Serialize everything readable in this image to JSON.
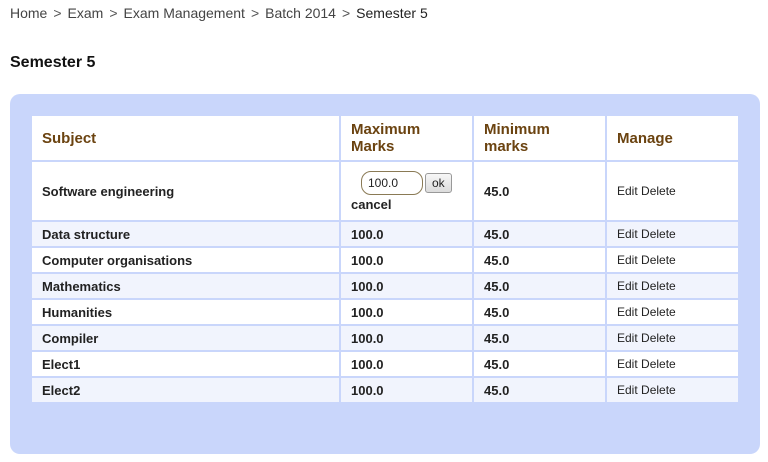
{
  "breadcrumb": {
    "items": [
      "Home",
      "Exam",
      "Exam Management",
      "Batch 2014"
    ],
    "current": "Semester 5",
    "separator": ">"
  },
  "page": {
    "title": "Semester 5"
  },
  "table": {
    "headers": {
      "subject": "Subject",
      "max_marks": "Maximum Marks",
      "min_marks": "Minimum marks",
      "manage": "Manage"
    },
    "edit_row": {
      "subject": "Software engineering",
      "max_value": "100.0",
      "ok_label": "ok",
      "cancel_label": "cancel",
      "min": "45.0"
    },
    "rows": [
      {
        "subject": "Data structure",
        "max": "100.0",
        "min": "45.0"
      },
      {
        "subject": "Computer organisations",
        "max": "100.0",
        "min": "45.0"
      },
      {
        "subject": "Mathematics",
        "max": "100.0",
        "min": "45.0"
      },
      {
        "subject": "Humanities",
        "max": "100.0",
        "min": "45.0"
      },
      {
        "subject": "Compiler",
        "max": "100.0",
        "min": "45.0"
      },
      {
        "subject": "Elect1",
        "max": "100.0",
        "min": "45.0"
      },
      {
        "subject": "Elect2",
        "max": "100.0",
        "min": "45.0"
      }
    ],
    "actions": {
      "edit": "Edit",
      "delete": "Delete"
    }
  },
  "colors": {
    "panel_background": "#c9d6fb",
    "header_text": "#6b4310"
  }
}
